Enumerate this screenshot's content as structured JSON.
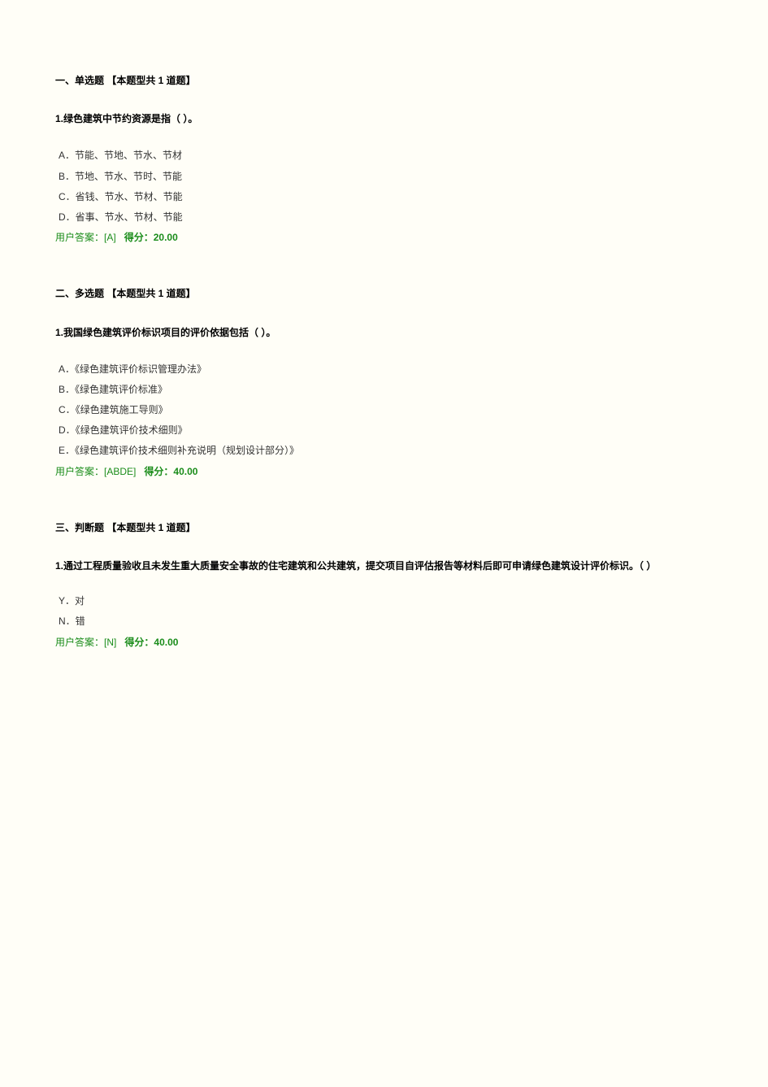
{
  "sections": [
    {
      "header": "一、单选题 【本题型共 1 道题】",
      "question": "1.绿色建筑中节约资源是指（ ）。",
      "options": [
        "A．节能、节地、节水、节材",
        "B．节地、节水、节时、节能",
        "C．省钱、节水、节材、节能",
        "D．省事、节水、节材、节能"
      ],
      "answerLabel": "用户答案：",
      "answerValue": "[A]",
      "scoreLabel": "得分：",
      "scoreValue": "20.00"
    },
    {
      "header": "二、多选题 【本题型共 1 道题】",
      "question": "1.我国绿色建筑评价标识项目的评价依据包括（ ）。",
      "options": [
        "A．《绿色建筑评价标识管理办法》",
        "B．《绿色建筑评价标准》",
        "C．《绿色建筑施工导则》",
        "D．《绿色建筑评价技术细则》",
        "E．《绿色建筑评价技术细则补充说明（规划设计部分）》"
      ],
      "answerLabel": "用户答案：",
      "answerValue": "[ABDE]",
      "scoreLabel": "得分：",
      "scoreValue": "40.00"
    },
    {
      "header": "三、判断题 【本题型共 1 道题】",
      "question": "1.通过工程质量验收且未发生重大质量安全事故的住宅建筑和公共建筑，提交项目自评估报告等材料后即可申请绿色建筑设计评价标识。（ ）",
      "options": [
        "Y．对",
        "N．错"
      ],
      "answerLabel": "用户答案：",
      "answerValue": "[N]",
      "scoreLabel": "得分：",
      "scoreValue": "40.00"
    }
  ]
}
